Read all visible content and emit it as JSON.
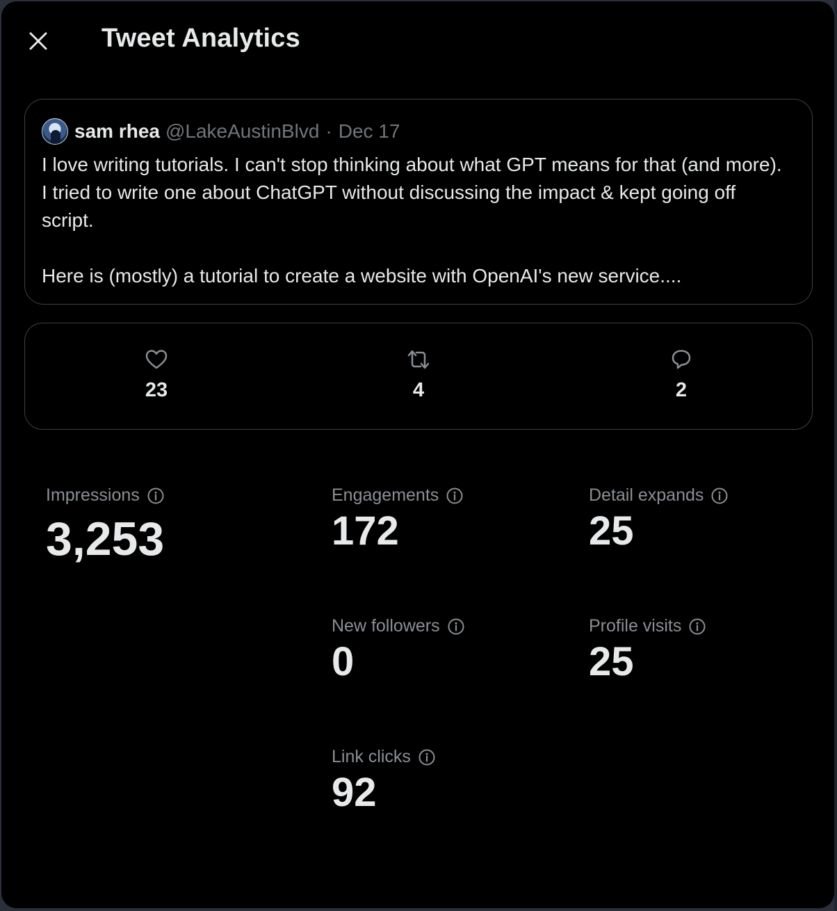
{
  "header": {
    "title": "Tweet Analytics"
  },
  "tweet": {
    "author_name": "sam rhea",
    "handle": "@LakeAustinBlvd",
    "separator": "·",
    "date": "Dec 17",
    "paragraphs": [
      "I love writing tutorials. I can't stop thinking about what GPT means for that (and more). I tried to write one about ChatGPT without discussing the impact & kept going off script.",
      "Here is (mostly) a tutorial to create a website with OpenAI's new service...."
    ]
  },
  "metrics": {
    "likes": "23",
    "retweets": "4",
    "replies": "2"
  },
  "stats": {
    "impressions": {
      "label": "Impressions",
      "value": "3,253"
    },
    "engagements": {
      "label": "Engagements",
      "value": "172"
    },
    "detail_expands": {
      "label": "Detail expands",
      "value": "25"
    },
    "new_followers": {
      "label": "New followers",
      "value": "0"
    },
    "profile_visits": {
      "label": "Profile visits",
      "value": "25"
    },
    "link_clicks": {
      "label": "Link clicks",
      "value": "92"
    }
  },
  "icons": {
    "close": "close-icon",
    "like": "heart-icon",
    "retweet": "retweet-icon",
    "reply": "reply-icon",
    "info": "info-icon"
  },
  "colors": {
    "background": "#000000",
    "text_primary": "#e7e9ea",
    "text_secondary": "#71767b",
    "border": "#3e4144"
  }
}
